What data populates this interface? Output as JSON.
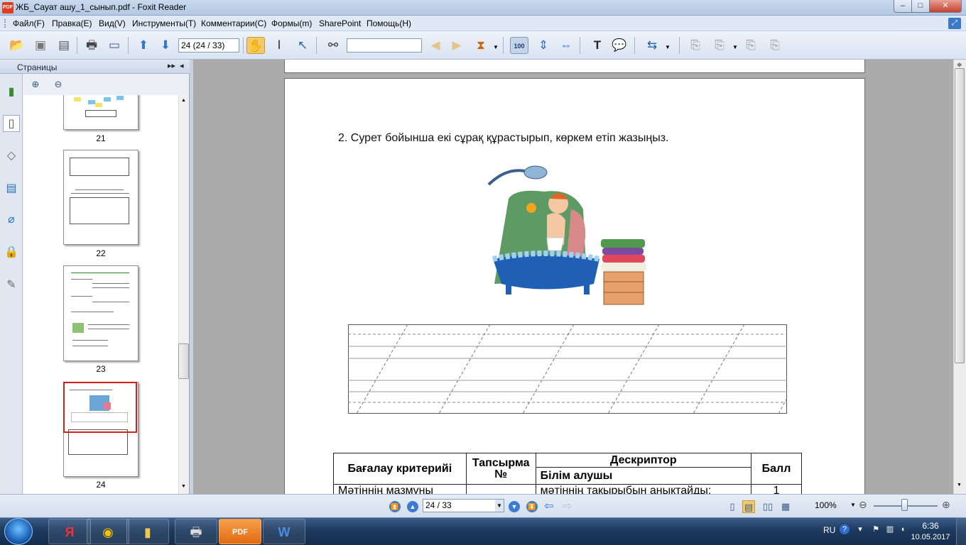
{
  "window": {
    "title": "ЖБ_Сауат ашу_1_сынып.pdf - Foxit Reader",
    "app_icon": "PDF",
    "min": "–",
    "max": "□",
    "close": "✕"
  },
  "menu": [
    "Файл(F)",
    "Правка(E)",
    "Вид(V)",
    "Инструменты(T)",
    "Комментарии(C)",
    "Формы(m)",
    "SharePoint",
    "Помощь(H)"
  ],
  "toolbar": {
    "page_field": "24 (24 / 33)",
    "search_placeholder": ""
  },
  "panel": {
    "title": "Страницы",
    "expand": "▸▸",
    "collapse": "◂"
  },
  "thumbnails": [
    {
      "label": "21"
    },
    {
      "label": "22"
    },
    {
      "label": "23"
    },
    {
      "label": "24",
      "selected": true
    }
  ],
  "document": {
    "task": "2. Сурет бойынша екі сұрақ құрастырып, көркем етіп жазыңыз.",
    "table": {
      "h_criterion": "Бағалау критерийі",
      "h_task": "Тапсырма №",
      "h_descriptor": "Дескриптор",
      "h_learner": "Білім алушы",
      "h_score": "Балл",
      "row1_criterion": "Мәтіннің мазмұны",
      "row1_task": "",
      "row1_descriptor": "мәтіннің тақырыбын анықтайды;",
      "row1_score": "1"
    }
  },
  "status": {
    "page_select": "24 / 33",
    "zoom": "100%"
  },
  "tray": {
    "lang": "RU",
    "time": "6:36",
    "date": "10.05.2017"
  }
}
